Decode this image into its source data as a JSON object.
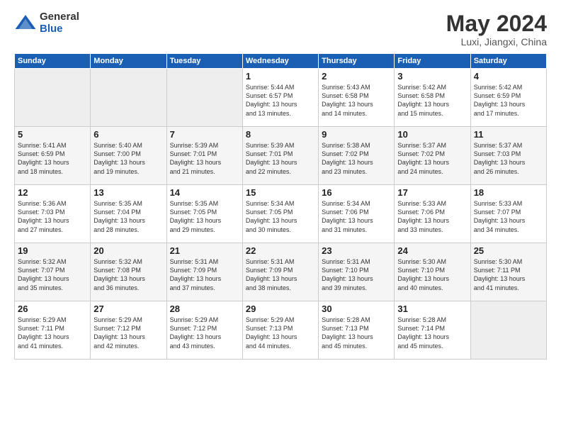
{
  "logo": {
    "general": "General",
    "blue": "Blue"
  },
  "title": "May 2024",
  "location": "Luxi, Jiangxi, China",
  "weekdays": [
    "Sunday",
    "Monday",
    "Tuesday",
    "Wednesday",
    "Thursday",
    "Friday",
    "Saturday"
  ],
  "weeks": [
    [
      {
        "day": "",
        "info": ""
      },
      {
        "day": "",
        "info": ""
      },
      {
        "day": "",
        "info": ""
      },
      {
        "day": "1",
        "info": "Sunrise: 5:44 AM\nSunset: 6:57 PM\nDaylight: 13 hours\nand 13 minutes."
      },
      {
        "day": "2",
        "info": "Sunrise: 5:43 AM\nSunset: 6:58 PM\nDaylight: 13 hours\nand 14 minutes."
      },
      {
        "day": "3",
        "info": "Sunrise: 5:42 AM\nSunset: 6:58 PM\nDaylight: 13 hours\nand 15 minutes."
      },
      {
        "day": "4",
        "info": "Sunrise: 5:42 AM\nSunset: 6:59 PM\nDaylight: 13 hours\nand 17 minutes."
      }
    ],
    [
      {
        "day": "5",
        "info": "Sunrise: 5:41 AM\nSunset: 6:59 PM\nDaylight: 13 hours\nand 18 minutes."
      },
      {
        "day": "6",
        "info": "Sunrise: 5:40 AM\nSunset: 7:00 PM\nDaylight: 13 hours\nand 19 minutes."
      },
      {
        "day": "7",
        "info": "Sunrise: 5:39 AM\nSunset: 7:01 PM\nDaylight: 13 hours\nand 21 minutes."
      },
      {
        "day": "8",
        "info": "Sunrise: 5:39 AM\nSunset: 7:01 PM\nDaylight: 13 hours\nand 22 minutes."
      },
      {
        "day": "9",
        "info": "Sunrise: 5:38 AM\nSunset: 7:02 PM\nDaylight: 13 hours\nand 23 minutes."
      },
      {
        "day": "10",
        "info": "Sunrise: 5:37 AM\nSunset: 7:02 PM\nDaylight: 13 hours\nand 24 minutes."
      },
      {
        "day": "11",
        "info": "Sunrise: 5:37 AM\nSunset: 7:03 PM\nDaylight: 13 hours\nand 26 minutes."
      }
    ],
    [
      {
        "day": "12",
        "info": "Sunrise: 5:36 AM\nSunset: 7:03 PM\nDaylight: 13 hours\nand 27 minutes."
      },
      {
        "day": "13",
        "info": "Sunrise: 5:35 AM\nSunset: 7:04 PM\nDaylight: 13 hours\nand 28 minutes."
      },
      {
        "day": "14",
        "info": "Sunrise: 5:35 AM\nSunset: 7:05 PM\nDaylight: 13 hours\nand 29 minutes."
      },
      {
        "day": "15",
        "info": "Sunrise: 5:34 AM\nSunset: 7:05 PM\nDaylight: 13 hours\nand 30 minutes."
      },
      {
        "day": "16",
        "info": "Sunrise: 5:34 AM\nSunset: 7:06 PM\nDaylight: 13 hours\nand 31 minutes."
      },
      {
        "day": "17",
        "info": "Sunrise: 5:33 AM\nSunset: 7:06 PM\nDaylight: 13 hours\nand 33 minutes."
      },
      {
        "day": "18",
        "info": "Sunrise: 5:33 AM\nSunset: 7:07 PM\nDaylight: 13 hours\nand 34 minutes."
      }
    ],
    [
      {
        "day": "19",
        "info": "Sunrise: 5:32 AM\nSunset: 7:07 PM\nDaylight: 13 hours\nand 35 minutes."
      },
      {
        "day": "20",
        "info": "Sunrise: 5:32 AM\nSunset: 7:08 PM\nDaylight: 13 hours\nand 36 minutes."
      },
      {
        "day": "21",
        "info": "Sunrise: 5:31 AM\nSunset: 7:09 PM\nDaylight: 13 hours\nand 37 minutes."
      },
      {
        "day": "22",
        "info": "Sunrise: 5:31 AM\nSunset: 7:09 PM\nDaylight: 13 hours\nand 38 minutes."
      },
      {
        "day": "23",
        "info": "Sunrise: 5:31 AM\nSunset: 7:10 PM\nDaylight: 13 hours\nand 39 minutes."
      },
      {
        "day": "24",
        "info": "Sunrise: 5:30 AM\nSunset: 7:10 PM\nDaylight: 13 hours\nand 40 minutes."
      },
      {
        "day": "25",
        "info": "Sunrise: 5:30 AM\nSunset: 7:11 PM\nDaylight: 13 hours\nand 41 minutes."
      }
    ],
    [
      {
        "day": "26",
        "info": "Sunrise: 5:29 AM\nSunset: 7:11 PM\nDaylight: 13 hours\nand 41 minutes."
      },
      {
        "day": "27",
        "info": "Sunrise: 5:29 AM\nSunset: 7:12 PM\nDaylight: 13 hours\nand 42 minutes."
      },
      {
        "day": "28",
        "info": "Sunrise: 5:29 AM\nSunset: 7:12 PM\nDaylight: 13 hours\nand 43 minutes."
      },
      {
        "day": "29",
        "info": "Sunrise: 5:29 AM\nSunset: 7:13 PM\nDaylight: 13 hours\nand 44 minutes."
      },
      {
        "day": "30",
        "info": "Sunrise: 5:28 AM\nSunset: 7:13 PM\nDaylight: 13 hours\nand 45 minutes."
      },
      {
        "day": "31",
        "info": "Sunrise: 5:28 AM\nSunset: 7:14 PM\nDaylight: 13 hours\nand 45 minutes."
      },
      {
        "day": "",
        "info": ""
      }
    ]
  ]
}
